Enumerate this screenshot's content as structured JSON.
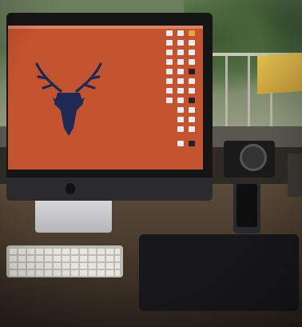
{
  "scene": {
    "description_colors": {
      "wallpaper": "#c4532f",
      "deer_logo": "#1e2a55"
    },
    "icons": [
      "deer-logo-icon",
      "apple-logo-icon",
      "desktop-file-icon"
    ]
  }
}
